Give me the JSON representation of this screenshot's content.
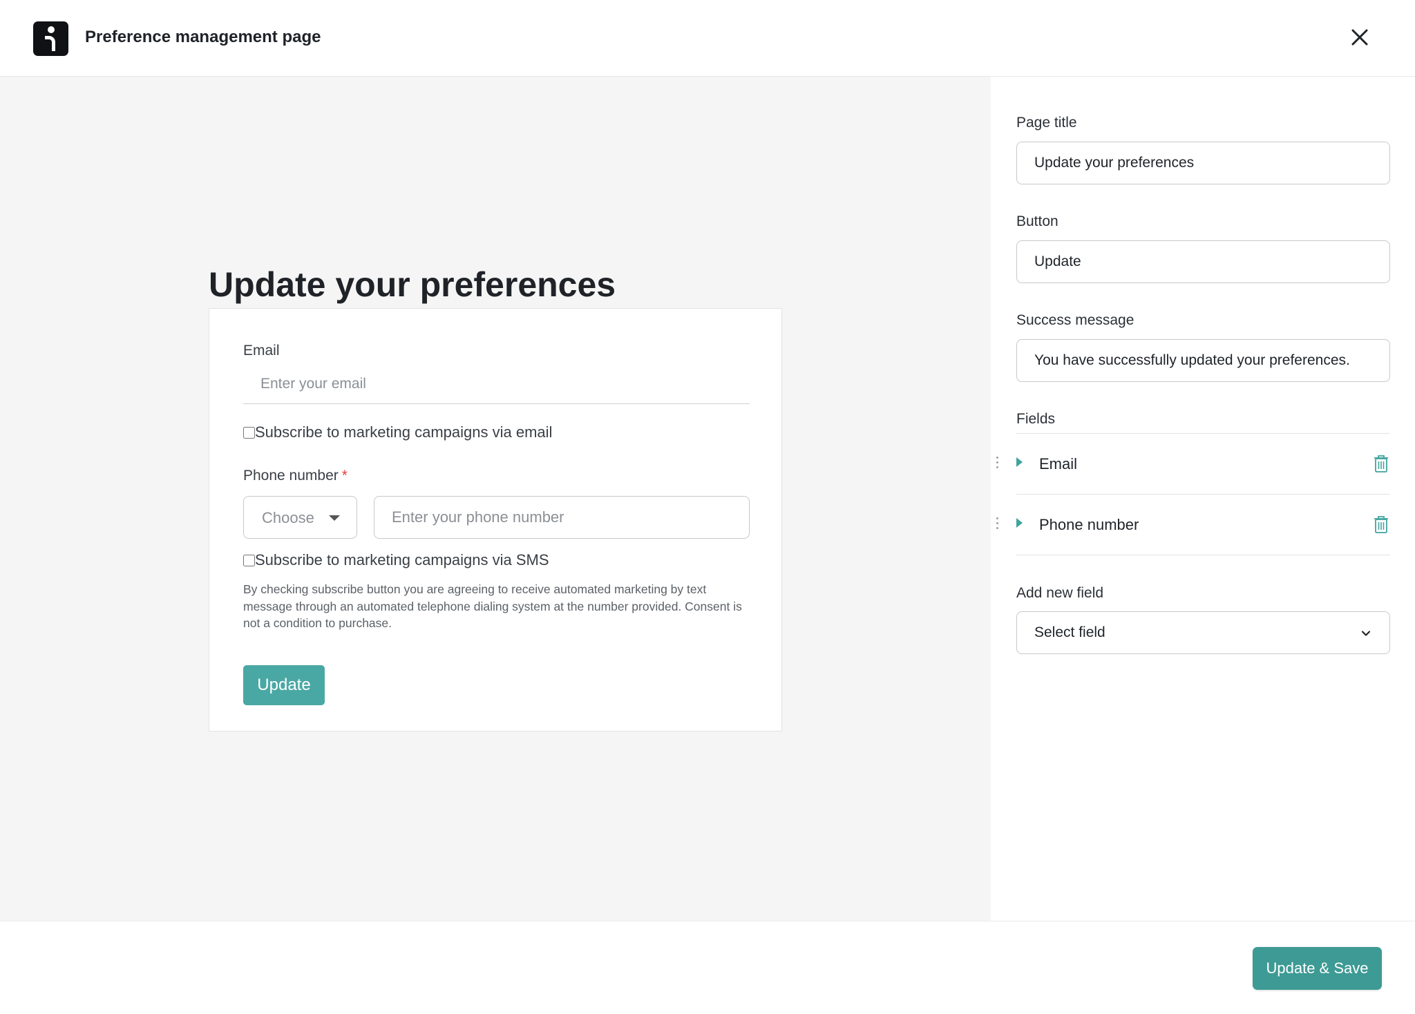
{
  "header": {
    "title": "Preference management page"
  },
  "preview": {
    "title": "Update your preferences",
    "email": {
      "label": "Email",
      "placeholder": "Enter your email",
      "subscribe_label": "Subscribe to marketing campaigns via email"
    },
    "phone": {
      "label": "Phone number",
      "required_mark": "*",
      "country_placeholder": "Choose",
      "placeholder": "Enter your phone number",
      "subscribe_label": "Subscribe to marketing campaigns via SMS",
      "disclaimer": "By checking subscribe button you are agreeing to receive automated marketing by text message through an automated telephone dialing system at the number provided. Consent is not a condition to purchase."
    },
    "button_label": "Update"
  },
  "settings": {
    "page_title": {
      "label": "Page title",
      "value": "Update your preferences"
    },
    "button": {
      "label": "Button",
      "value": "Update"
    },
    "success_message": {
      "label": "Success message",
      "value": "You have successfully updated your preferences."
    },
    "fields": {
      "label": "Fields",
      "items": [
        {
          "name": "Email"
        },
        {
          "name": "Phone number"
        }
      ]
    },
    "add_new_field": {
      "label": "Add new field",
      "value": "Select field"
    }
  },
  "footer": {
    "save_label": "Update & Save"
  },
  "colors": {
    "accent": "#4aa8a4",
    "save_button": "#3d9a94",
    "required": "#e03d3d",
    "preview_background": "#f5f5f5"
  },
  "icons": [
    "logo-icon",
    "close-icon",
    "chevron-down-icon",
    "drag-handle-icon",
    "expand-arrow-icon",
    "trash-icon"
  ]
}
